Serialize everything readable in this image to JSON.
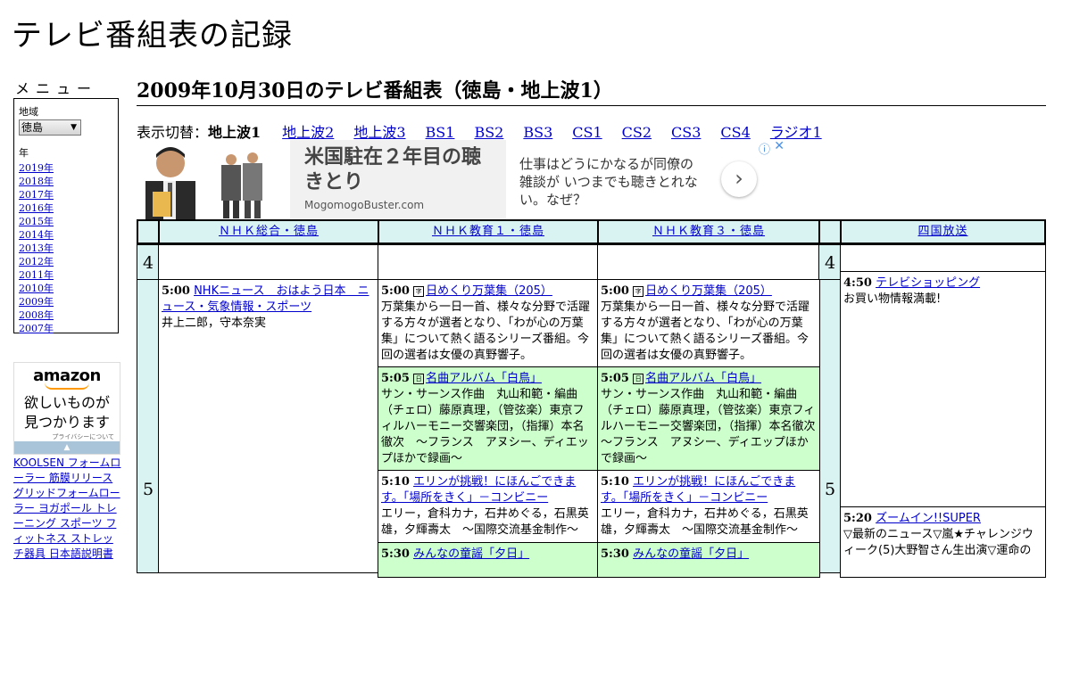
{
  "site_title": "テレビ番組表の記録",
  "sidebar": {
    "menu_heading": "メニュー",
    "region_label": "地域",
    "region_value": "徳島",
    "year_label": "年",
    "years": [
      "2019年",
      "2018年",
      "2017年",
      "2016年",
      "2015年",
      "2014年",
      "2013年",
      "2012年",
      "2011年",
      "2010年",
      "2009年",
      "2008年",
      "2007年"
    ],
    "amazon": {
      "logo": "amazon",
      "tagline_1": "欲しいものが",
      "tagline_2": "見つかります",
      "privacy": "プライバシーについて"
    },
    "keywords": "KOOLSEN フォームローラー 筋膜リリース グリッドフォームローラー ヨガポール トレーニング スポーツ フィットネス ストレッチ器具 日本語説明書"
  },
  "page_heading": "2009年10月30日のテレビ番組表（徳島・地上波1）",
  "tabs": {
    "label": "表示切替：",
    "current": "地上波1",
    "items": [
      "地上波2",
      "地上波3",
      "BS1",
      "BS2",
      "BS3",
      "CS1",
      "CS2",
      "CS3",
      "CS4",
      "ラジオ1"
    ]
  },
  "banner_ad": {
    "headline": "米国駐在２年目の聴きとり",
    "source": "MogomogoBuster.com",
    "body": "仕事はどうにかなるが同僚の雑談が いつまでも聴きとれない。なぜ？",
    "next_symbol": "›",
    "info_symbol": "ⓘ",
    "close_symbol": "✕"
  },
  "grid": {
    "channels": [
      "ＮＨＫ総合・徳島",
      "ＮＨＫ教育１・徳島",
      "ＮＨＫ教育３・徳島",
      "四国放送"
    ],
    "hours": [
      "4",
      "5"
    ],
    "programs": {
      "ch1_0500": {
        "time": "5:00",
        "title": "NHKニュース　おはよう日本　ニュース・気象情報・スポーツ",
        "desc": "井上二郎，守本奈実"
      },
      "ch2_0500": {
        "time": "5:00",
        "badge": "字",
        "title": "日めくり万葉集（205）",
        "desc": "万葉集から一日一首、様々な分野で活躍する方々が選者となり、「わが心の万葉集」について熱く語るシリーズ番組。今回の選者は女優の真野響子。"
      },
      "ch3_0500": {
        "time": "5:00",
        "badge": "字",
        "title": "日めくり万葉集（205）",
        "desc": "万葉集から一日一首、様々な分野で活躍する方々が選者となり、「わが心の万葉集」について熱く語るシリーズ番組。今回の選者は女優の真野響子。"
      },
      "ch2_0505": {
        "time": "5:05",
        "badge": "日",
        "title": "名曲アルバム「白鳥」",
        "desc": "サン・サーンス作曲　丸山和範・編曲（チェロ）藤原真理，（管弦楽）東京フィルハーモニー交響楽団，（指揮）本名徹次　～フランス　アヌシー、ディエップほかで録画～"
      },
      "ch3_0505": {
        "time": "5:05",
        "badge": "日",
        "title": "名曲アルバム「白鳥」",
        "desc": "サン・サーンス作曲　丸山和範・編曲（チェロ）藤原真理，（管弦楽）東京フィルハーモニー交響楽団，（指揮）本名徹次　～フランス　アヌシー、ディエップほかで録画～"
      },
      "ch2_0510": {
        "time": "5:10",
        "title": "エリンが挑戦！にほんごできます。「場所をきく」－コンビニー",
        "desc": "エリー，倉科カナ，石井めぐる，石黒英雄，夕輝壽太　～国際交流基金制作～"
      },
      "ch3_0510": {
        "time": "5:10",
        "title": "エリンが挑戦！にほんごできます。「場所をきく」－コンビニー",
        "desc": "エリー，倉科カナ，石井めぐる，石黒英雄，夕輝壽太　～国際交流基金制作～"
      },
      "ch2_0530": {
        "time": "5:30",
        "title": "みんなの童謡「夕日」",
        "desc": ""
      },
      "ch3_0530": {
        "time": "5:30",
        "title": "みんなの童謡「夕日」",
        "desc": ""
      },
      "ch4_0450": {
        "time": "4:50",
        "title": "テレビショッピング",
        "desc": "お買い物情報満載!"
      },
      "ch4_0520": {
        "time": "5:20",
        "title": "ズームイン!!SUPER",
        "desc": "▽最新のニュース▽嵐★チャレンジウィーク(5)大野智さん生出演▽運命の"
      }
    }
  },
  "colors": {
    "header_bg": "#d9f2f2",
    "hour_bg": "#d9f2f2",
    "green_cell": "#ccffcc",
    "link": "#0000cc"
  }
}
